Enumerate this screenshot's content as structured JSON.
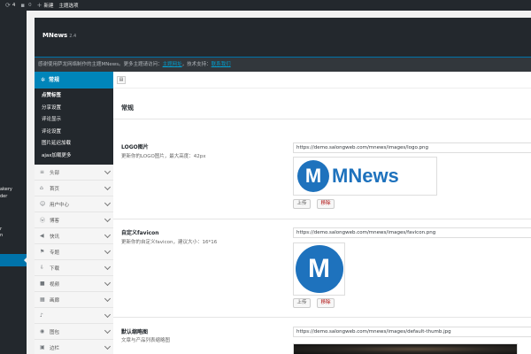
{
  "admin_bar": {
    "comments_count": "4",
    "updates_count": "0",
    "new_label": "新建",
    "theme_options_label": "主题选项"
  },
  "admin_menu": {
    "fragments": [
      "akery",
      "der",
      "r",
      "n"
    ]
  },
  "header": {
    "title": "MNews",
    "version": "2.4"
  },
  "notice": {
    "text": "感谢使用萨龙网络制作的主题MNews。更多主题请访问：",
    "link1": "主题网址",
    "middle": "，技术支持：",
    "link2": "联系我们"
  },
  "sidebar": {
    "active": {
      "icon": "gear-icon",
      "label": "常规"
    },
    "sub_items": [
      "点赞标签",
      "分享设置",
      "评论显示",
      "评论设置",
      "图片延迟加载",
      "ajax加载更多"
    ],
    "items": [
      {
        "label": "头部",
        "icon": "bars-icon"
      },
      {
        "label": "首页",
        "icon": "home-icon"
      },
      {
        "label": "用户中心",
        "icon": "users-icon"
      },
      {
        "label": "博客",
        "icon": "wordpress-icon"
      },
      {
        "label": "快讯",
        "icon": "megaphone-icon"
      },
      {
        "label": "专题",
        "icon": "flag-icon"
      },
      {
        "label": "下载",
        "icon": "download-icon"
      },
      {
        "label": "视频",
        "icon": "video-icon"
      },
      {
        "label": "画廊",
        "icon": "gallery-icon"
      },
      {
        "label": "",
        "icon": "bell-icon"
      },
      {
        "label": "图包",
        "icon": "camera-icon"
      },
      {
        "label": "边栏",
        "icon": "sidebar-icon"
      }
    ]
  },
  "main": {
    "section_title": "常规",
    "options": [
      {
        "label": "LOGO图片",
        "desc": "更新你的LOGO图片，最大高度：42px",
        "url": "https://demo.salongweb.com/mnews/images/logo.png",
        "preview_letter": "M",
        "preview_text": "MNews"
      },
      {
        "label": "自定义favicon",
        "desc": "更新你的自定义favicon，建议大小：16*16",
        "url": "https://demo.salongweb.com/mnews/images/favicon.png",
        "preview_letter": "M"
      },
      {
        "label": "默认缩略图",
        "desc": "文章与产品列表缩略图",
        "url": "https://demo.salongweb.com/mnews/images/default-thumb.jpg"
      }
    ],
    "upload_label": "上传",
    "remove_label": "移除"
  }
}
